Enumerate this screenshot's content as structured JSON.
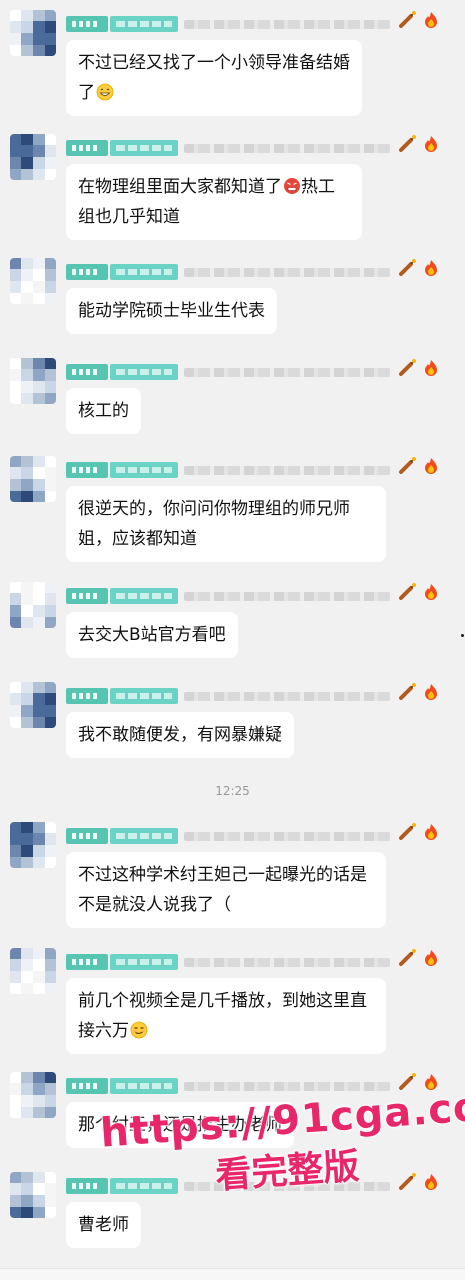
{
  "messages": [
    {
      "text_before": "不过已经又找了一个小领导准备结婚了",
      "inline_emoji": "grin-emoji",
      "text_after": ""
    },
    {
      "text_before": "在物理组里面大家都知道了",
      "inline_emoji": "angry-face-emoji",
      "text_after": "热工组也几乎知道"
    },
    {
      "text_before": "能动学院硕士毕业生代表",
      "inline_emoji": "",
      "text_after": ""
    },
    {
      "text_before": "核工的",
      "inline_emoji": "",
      "text_after": ""
    },
    {
      "text_before": "很逆天的，你问问你物理组的师兄师姐，应该都知道",
      "inline_emoji": "",
      "text_after": ""
    },
    {
      "text_before": "去交大B站官方看吧",
      "inline_emoji": "",
      "text_after": ""
    },
    {
      "text_before": "我不敢随便发，有网暴嫌疑",
      "inline_emoji": "",
      "text_after": ""
    },
    {
      "text_before": "不过这种学术纣王妲己一起曝光的话是不是就没人说我了（",
      "inline_emoji": "",
      "text_after": ""
    },
    {
      "text_before": "前几个视频全是几千播放，到她这里直接六万",
      "inline_emoji": "smirk-emoji",
      "text_after": ""
    },
    {
      "text_before": "那个纣王，还是招生办老师",
      "inline_emoji": "",
      "text_after": ""
    },
    {
      "text_before": "曹老师",
      "inline_emoji": "",
      "text_after": ""
    }
  ],
  "timestamp": "12:25",
  "watermark": {
    "url": "https://91cga.co",
    "sub": "看完整版"
  },
  "colors": {
    "background": "#f1f1f1",
    "bubble": "#ffffff",
    "tag": "#56c6b2",
    "watermark": "#e8276b"
  },
  "icons": {
    "badge_left": "firecracker-icon",
    "badge_right": "flame-icon"
  }
}
